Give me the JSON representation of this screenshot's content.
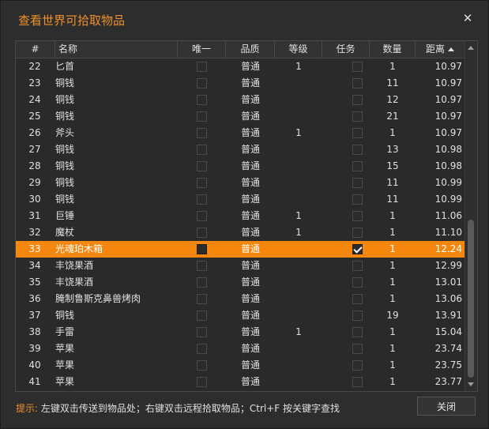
{
  "window": {
    "title": "查看世界可拾取物品",
    "close_symbol": "✕"
  },
  "table": {
    "columns": [
      "#",
      "名称",
      "唯一",
      "品质",
      "等级",
      "任务",
      "数量",
      "距离"
    ],
    "sort_column": "距离",
    "rows": [
      {
        "idx": "22",
        "name": "匕首",
        "unique": false,
        "quality": "普通",
        "level": "1",
        "task": false,
        "qty": "1",
        "dist": "10.97"
      },
      {
        "idx": "23",
        "name": "铜钱",
        "unique": false,
        "quality": "普通",
        "level": "",
        "task": false,
        "qty": "11",
        "dist": "10.97"
      },
      {
        "idx": "24",
        "name": "铜钱",
        "unique": false,
        "quality": "普通",
        "level": "",
        "task": false,
        "qty": "12",
        "dist": "10.97"
      },
      {
        "idx": "25",
        "name": "铜钱",
        "unique": false,
        "quality": "普通",
        "level": "",
        "task": false,
        "qty": "21",
        "dist": "10.97"
      },
      {
        "idx": "26",
        "name": "斧头",
        "unique": false,
        "quality": "普通",
        "level": "1",
        "task": false,
        "qty": "1",
        "dist": "10.97"
      },
      {
        "idx": "27",
        "name": "铜钱",
        "unique": false,
        "quality": "普通",
        "level": "",
        "task": false,
        "qty": "13",
        "dist": "10.98"
      },
      {
        "idx": "28",
        "name": "铜钱",
        "unique": false,
        "quality": "普通",
        "level": "",
        "task": false,
        "qty": "15",
        "dist": "10.98"
      },
      {
        "idx": "29",
        "name": "铜钱",
        "unique": false,
        "quality": "普通",
        "level": "",
        "task": false,
        "qty": "11",
        "dist": "10.99"
      },
      {
        "idx": "30",
        "name": "铜钱",
        "unique": false,
        "quality": "普通",
        "level": "",
        "task": false,
        "qty": "11",
        "dist": "10.99"
      },
      {
        "idx": "31",
        "name": "巨锤",
        "unique": false,
        "quality": "普通",
        "level": "1",
        "task": false,
        "qty": "1",
        "dist": "11.06"
      },
      {
        "idx": "32",
        "name": "魔杖",
        "unique": false,
        "quality": "普通",
        "level": "1",
        "task": false,
        "qty": "1",
        "dist": "11.10"
      },
      {
        "idx": "33",
        "name": "光魂珀木箱",
        "unique": false,
        "quality": "普通",
        "level": "",
        "task": true,
        "qty": "1",
        "dist": "12.24",
        "selected": true
      },
      {
        "idx": "34",
        "name": "丰饶果酒",
        "unique": false,
        "quality": "普通",
        "level": "",
        "task": false,
        "qty": "1",
        "dist": "12.99"
      },
      {
        "idx": "35",
        "name": "丰饶果酒",
        "unique": false,
        "quality": "普通",
        "level": "",
        "task": false,
        "qty": "1",
        "dist": "13.01"
      },
      {
        "idx": "36",
        "name": "腌制鲁斯克鼻兽烤肉",
        "unique": false,
        "quality": "普通",
        "level": "",
        "task": false,
        "qty": "1",
        "dist": "13.06"
      },
      {
        "idx": "37",
        "name": "铜钱",
        "unique": false,
        "quality": "普通",
        "level": "",
        "task": false,
        "qty": "19",
        "dist": "13.91"
      },
      {
        "idx": "38",
        "name": "手雷",
        "unique": false,
        "quality": "普通",
        "level": "1",
        "task": false,
        "qty": "1",
        "dist": "15.04"
      },
      {
        "idx": "39",
        "name": "苹果",
        "unique": false,
        "quality": "普通",
        "level": "",
        "task": false,
        "qty": "1",
        "dist": "23.74"
      },
      {
        "idx": "40",
        "name": "苹果",
        "unique": false,
        "quality": "普通",
        "level": "",
        "task": false,
        "qty": "1",
        "dist": "23.75"
      },
      {
        "idx": "41",
        "name": "苹果",
        "unique": false,
        "quality": "普通",
        "level": "",
        "task": false,
        "qty": "1",
        "dist": "23.77"
      }
    ]
  },
  "footer": {
    "hint_prefix": "提示:",
    "hint_text": "左键双击传送到物品处；右键双击远程拾取物品；Ctrl+F 按关键字查找",
    "close_label": "关闭"
  },
  "colors": {
    "accent": "#f0902a",
    "selected_row": "#f5870f",
    "background": "#2d2d2d"
  }
}
